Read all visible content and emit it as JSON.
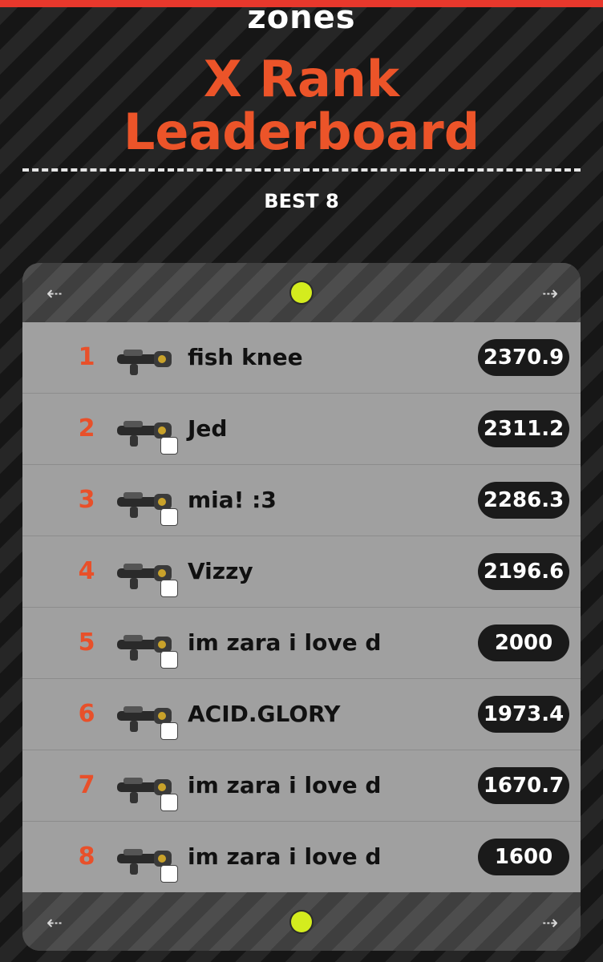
{
  "header": {
    "mode": "zones",
    "title_line1": "X Rank",
    "title_line2": "Leaderboard",
    "subtitle": "BEST 8"
  },
  "colors": {
    "accent_orange": "#ec5429",
    "top_bar_red": "#e8382c",
    "nav_dot": "#d4ec1e",
    "row_bg": "#a0a0a0",
    "score_pill": "#1a1a1a"
  },
  "nav": {
    "prev_icon": "arrow-left-icon",
    "prev_glyph": "⇠",
    "next_icon": "arrow-right-icon",
    "next_glyph": "⇢"
  },
  "entries": [
    {
      "rank": "1",
      "name": "fish knee",
      "score": "2370.9",
      "weapon_icon": "weapon-icon",
      "badge_icon": ""
    },
    {
      "rank": "2",
      "name": "Jed",
      "score": "2311.2",
      "weapon_icon": "weapon-icon",
      "badge_icon": "badge-icon"
    },
    {
      "rank": "3",
      "name": "mia! :3",
      "score": "2286.3",
      "weapon_icon": "weapon-icon",
      "badge_icon": "badge-icon"
    },
    {
      "rank": "4",
      "name": "Vizzy",
      "score": "2196.6",
      "weapon_icon": "weapon-icon",
      "badge_icon": "badge-icon"
    },
    {
      "rank": "5",
      "name": "im zara i love d",
      "score": "2000",
      "weapon_icon": "weapon-icon",
      "badge_icon": "badge-icon"
    },
    {
      "rank": "6",
      "name": "ACID.GLORY",
      "score": "1973.4",
      "weapon_icon": "weapon-icon",
      "badge_icon": "badge-icon"
    },
    {
      "rank": "7",
      "name": "im zara i love d",
      "score": "1670.7",
      "weapon_icon": "weapon-icon",
      "badge_icon": "badge-icon"
    },
    {
      "rank": "8",
      "name": "im zara i love d",
      "score": "1600",
      "weapon_icon": "weapon-icon",
      "badge_icon": "badge-icon"
    }
  ]
}
